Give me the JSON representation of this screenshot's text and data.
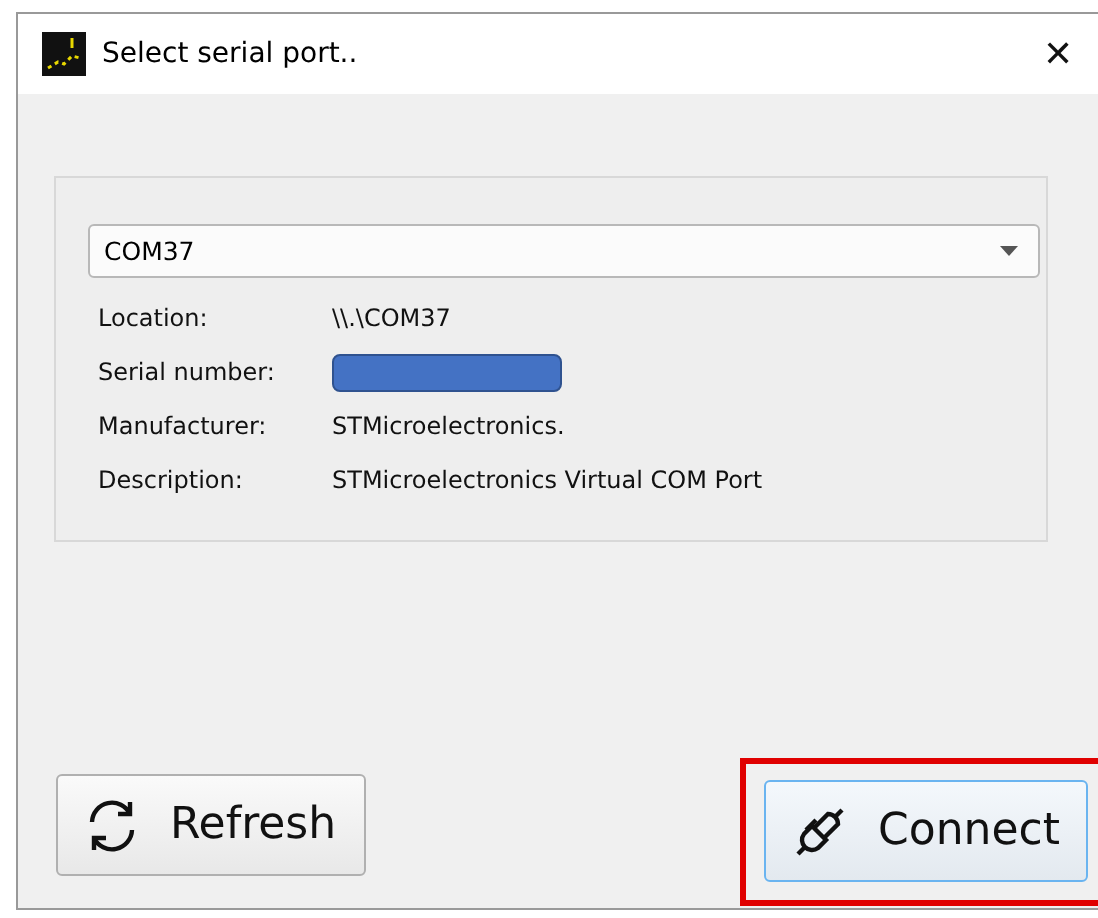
{
  "window": {
    "title": "Select serial port..",
    "close": "✕"
  },
  "port": {
    "value": "COM37"
  },
  "details": [
    {
      "label": "Location:",
      "value": "\\\\.\\COM37",
      "kind": "text"
    },
    {
      "label": "Serial number:",
      "kind": "redacted"
    },
    {
      "label": "Manufacturer:",
      "value": "STMicroelectronics.",
      "kind": "text"
    },
    {
      "label": "Description:",
      "value": "STMicroelectronics Virtual COM Port",
      "kind": "text"
    }
  ],
  "buttons": [
    {
      "label": "Refresh",
      "kind": "refresh",
      "highlighted": false
    },
    {
      "label": "Connect",
      "kind": "connect",
      "highlighted": true
    }
  ]
}
